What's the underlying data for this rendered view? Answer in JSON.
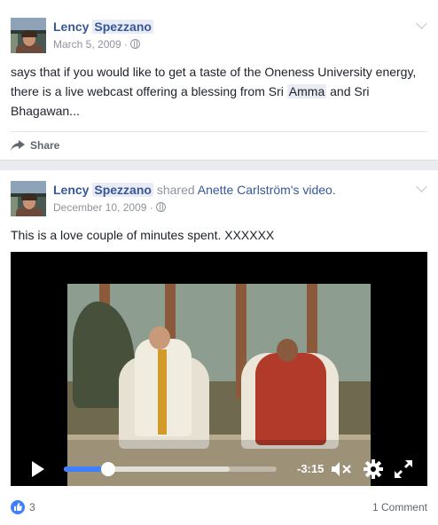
{
  "posts": [
    {
      "author_first": "Lency",
      "author_last": "Spezzano",
      "date": "March 5, 2009 ·",
      "text_before": "says that if you would like to get a taste of the Oneness University energy, there is a live webcast offering a blessing from Sri ",
      "text_highlight": "Amma",
      "text_after": " and Sri Bhagawan...",
      "share_label": "Share",
      "privacy_icon": "globe-icon"
    },
    {
      "author_first": "Lency",
      "author_last": "Spezzano",
      "shared_word": "shared",
      "shared_person": "Anette Carlström",
      "shared_suffix": "'s video.",
      "date": "December 10, 2009 ·",
      "text": "This is a love couple of minutes spent. XXXXXX",
      "video": {
        "time_remaining": "-3:15",
        "progress": 0.21,
        "buffered": 0.78
      },
      "like_count": "3",
      "comment_count": "1 Comment"
    }
  ],
  "colors": {
    "link": "#365899",
    "accent": "#4080ff",
    "background": "#e9ebee"
  }
}
